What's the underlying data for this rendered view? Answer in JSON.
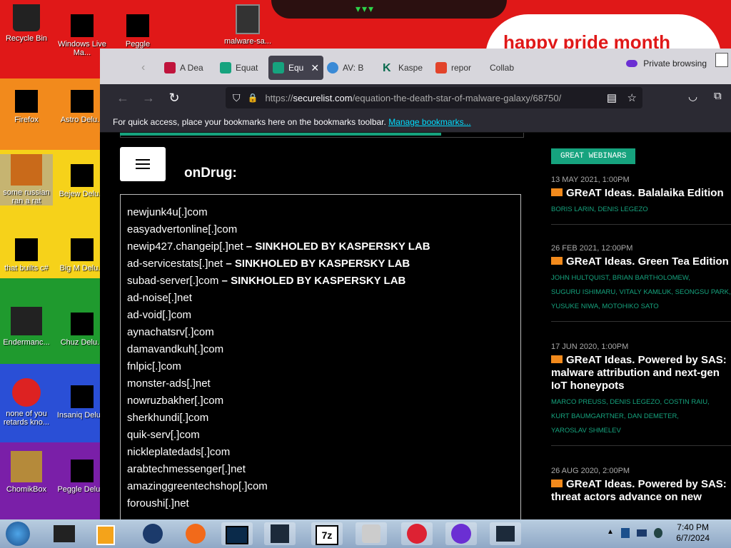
{
  "desktop": {
    "banner_text": "happy pride month",
    "icons": [
      {
        "label": "Recycle Bin"
      },
      {
        "label": "Windows Live Ma..."
      },
      {
        "label": "Peggle World..."
      },
      {
        "label": "malware-sa..."
      },
      {
        "label": "Firefox"
      },
      {
        "label": "Astro Delu..."
      },
      {
        "label": "some russian ran a rat"
      },
      {
        "label": "Bejew Delu..."
      },
      {
        "label": "that builts c#"
      },
      {
        "label": "Big M Delu..."
      },
      {
        "label": "Endermanc..."
      },
      {
        "label": "Chuz Delu..."
      },
      {
        "label": "none of you retards kno..."
      },
      {
        "label": "Insaniq Delu..."
      },
      {
        "label": "ChomikBox"
      },
      {
        "label": "Peggle Delu..."
      }
    ]
  },
  "browser": {
    "tabs": [
      {
        "label": "A Dea"
      },
      {
        "label": "Equat"
      },
      {
        "label": "Equ"
      },
      {
        "label": "AV: B"
      },
      {
        "label": "Kaspe"
      },
      {
        "label": "repor"
      },
      {
        "label": "Collab"
      }
    ],
    "private_label": "Private browsing",
    "url_prefix": "https://",
    "url_host": "securelist.com",
    "url_path": "/equation-the-death-star-of-malware-galaxy/68750/",
    "bookmarks_text": "For quick access, place your bookmarks here on the bookmarks toolbar.",
    "bookmarks_link": "Manage bookmarks...",
    "colors": {
      "accent": "#16a37e",
      "tabbar": "#d7d6dc",
      "toolbar": "#2b2a33"
    }
  },
  "article": {
    "section_title": "onDrug:",
    "domains": [
      {
        "name": "newjunk4u[.]com",
        "note": ""
      },
      {
        "name": "easyadvertonline[.]com",
        "note": ""
      },
      {
        "name": "newip427.changeip[.]net",
        "note": " – SINKHOLED BY KASPERSKY LAB"
      },
      {
        "name": "ad-servicestats[.]net",
        "note": " – SINKHOLED BY KASPERSKY LAB"
      },
      {
        "name": "subad-server[.]com",
        "note": " – SINKHOLED BY KASPERSKY LAB"
      },
      {
        "name": "ad-noise[.]net",
        "note": ""
      },
      {
        "name": "ad-void[.]com",
        "note": ""
      },
      {
        "name": "aynachatsrv[.]com",
        "note": ""
      },
      {
        "name": "damavandkuh[.]com",
        "note": ""
      },
      {
        "name": "fnlpic[.]com",
        "note": ""
      },
      {
        "name": "monster-ads[.]net",
        "note": ""
      },
      {
        "name": "nowruzbakher[.]com",
        "note": ""
      },
      {
        "name": "sherkhundi[.]com",
        "note": ""
      },
      {
        "name": "quik-serv[.]com",
        "note": ""
      },
      {
        "name": "nickleplatedads[.]com",
        "note": ""
      },
      {
        "name": "arabtechmessenger[.]net",
        "note": ""
      },
      {
        "name": "amazinggreentechshop[.]com",
        "note": ""
      },
      {
        "name": "foroushi[.]net",
        "note": ""
      }
    ]
  },
  "sidebar": {
    "badge": "GREAT WEBINARS",
    "entries": [
      {
        "date": "13 MAY 2021, 1:00PM",
        "title_lines": [
          "GReAT Ideas. Balalaika Edition"
        ],
        "authors": [
          "BORIS LARIN,  DENIS LEGEZO"
        ]
      },
      {
        "date": "26 FEB 2021, 12:00PM",
        "title_lines": [
          "GReAT Ideas. Green Tea Edition"
        ],
        "authors": [
          "JOHN HULTQUIST,  BRIAN BARTHOLOMEW,",
          "SUGURU ISHIMARU,  VITALY KAMLUK,  SEONGSU PARK,",
          "YUSUKE NIWA,  MOTOHIKO SATO"
        ]
      },
      {
        "date": "17 JUN 2020, 1:00PM",
        "title_lines": [
          "GReAT Ideas. Powered by SAS:",
          "malware attribution and next-gen",
          "IoT honeypots"
        ],
        "authors": [
          "MARCO PREUSS,  DENIS LEGEZO,  COSTIN RAIU,",
          "KURT BAUMGARTNER,  DAN DEMETER,",
          "YAROSLAV SHMELEV"
        ]
      },
      {
        "date": "26 AUG 2020, 2:00PM",
        "title_lines": [
          "GReAT Ideas. Powered by SAS:",
          "threat actors advance on new"
        ],
        "authors": []
      }
    ]
  },
  "taskbar": {
    "time": "7:40 PM",
    "date": "6/7/2024",
    "colors": {
      "bar": "#b9cde0"
    }
  }
}
